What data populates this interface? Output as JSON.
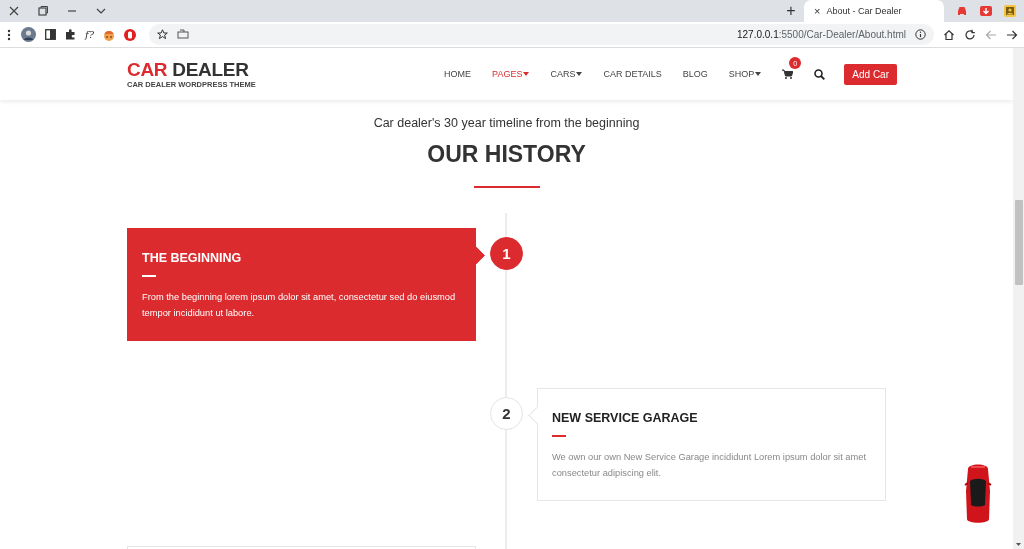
{
  "browser": {
    "new_tab": "+",
    "tab": {
      "title": "About - Car Dealer",
      "close": "×",
      "selected": true
    },
    "toolbar_label": "f?",
    "address": {
      "host": "127.0.0.1",
      "path": ":5500/Car-Dealer/About.html"
    }
  },
  "header": {
    "logo": {
      "accent": "CAR",
      "brand": "DEALER",
      "tagline": "CAR DEALER WORDPRESS THEME"
    },
    "nav": [
      {
        "label": "HOME",
        "selected": false,
        "dropdown": false
      },
      {
        "label": "PAGES",
        "selected": true,
        "dropdown": true
      },
      {
        "label": "CARS",
        "selected": false,
        "dropdown": true
      },
      {
        "label": "CAR DETAILS",
        "selected": false,
        "dropdown": false
      },
      {
        "label": "BLOG",
        "selected": false,
        "dropdown": false
      },
      {
        "label": "SHOP",
        "selected": false,
        "dropdown": true
      }
    ],
    "cart_count": "0",
    "button": "Add Car"
  },
  "history": {
    "subtitle": "Car dealer's 30 year timeline from the beginning",
    "title": "OUR HISTORY",
    "items": [
      {
        "number": "1",
        "title": "THE BEGINNING",
        "text": "From the beginning lorem ipsum dolor sit amet, consectetur sed do eiusmod tempor incididunt ut labore.",
        "kind": "left",
        "highlighted": true
      },
      {
        "number": "2",
        "title": "NEW SERVICE GARAGE",
        "text": "We own our own New Service Garage incididunt Lorem ipsum dolor sit amet consectetur adipiscing elit.",
        "kind": "right",
        "highlighted": false
      }
    ]
  }
}
